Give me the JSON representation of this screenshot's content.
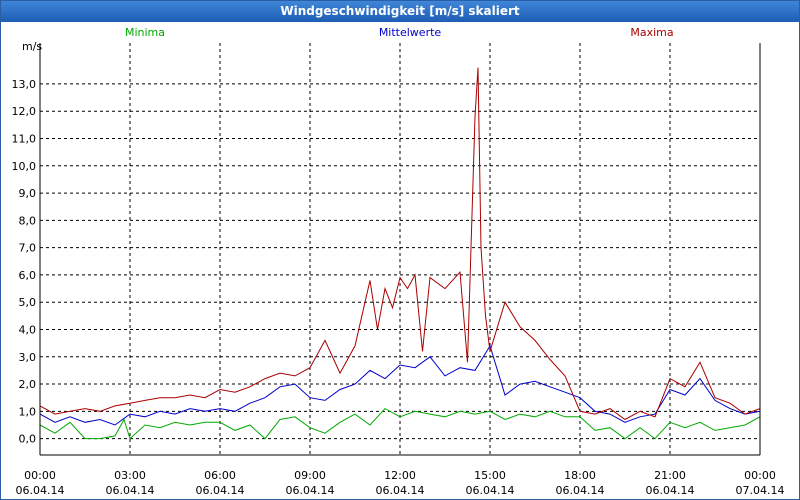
{
  "window": {
    "title": "Windgeschwindigkeit [m/s] skaliert"
  },
  "chart_data": {
    "type": "line",
    "ylabel": "m/s",
    "ylim": [
      -0.6,
      14.5
    ],
    "yticks": [
      0,
      1,
      2,
      3,
      4,
      5,
      6,
      7,
      8,
      9,
      10,
      11,
      12,
      13
    ],
    "ytick_labels": [
      "0,0",
      "1,0",
      "2,0",
      "3,0",
      "4,0",
      "5,0",
      "6,0",
      "7,0",
      "8,0",
      "9,0",
      "10,0",
      "11,0",
      "12,0",
      "13,0"
    ],
    "xlim": [
      0,
      24
    ],
    "xticks": [
      0,
      3,
      6,
      9,
      12,
      15,
      18,
      21,
      24
    ],
    "xtick_times": [
      "00:00",
      "03:00",
      "06:00",
      "09:00",
      "12:00",
      "15:00",
      "18:00",
      "21:00",
      "00:00"
    ],
    "xtick_dates": [
      "06.04.14",
      "06.04.14",
      "06.04.14",
      "06.04.14",
      "06.04.14",
      "06.04.14",
      "06.04.14",
      "06.04.14",
      "07.04.14"
    ],
    "grid": true,
    "series": [
      {
        "name": "Minima",
        "color": "#00aa00",
        "x": [
          0,
          0.5,
          1,
          1.5,
          2,
          2.5,
          2.8,
          3,
          3.5,
          4,
          4.5,
          5,
          5.5,
          6,
          6.5,
          7,
          7.5,
          8,
          8.5,
          9,
          9.5,
          10,
          10.5,
          11,
          11.5,
          12,
          12.5,
          13,
          13.5,
          14,
          14.5,
          15,
          15.5,
          16,
          16.5,
          17,
          17.5,
          18,
          18.5,
          19,
          19.5,
          20,
          20.5,
          21,
          21.5,
          22,
          22.5,
          23,
          23.5,
          24
        ],
        "y": [
          0.5,
          0.2,
          0.6,
          0.0,
          0.0,
          0.1,
          0.7,
          0.0,
          0.5,
          0.4,
          0.6,
          0.5,
          0.6,
          0.6,
          0.3,
          0.5,
          0.0,
          0.7,
          0.8,
          0.4,
          0.2,
          0.6,
          0.9,
          0.5,
          1.1,
          0.8,
          1.0,
          0.9,
          0.8,
          1.0,
          0.9,
          1.0,
          0.7,
          0.9,
          0.8,
          1.0,
          0.8,
          0.8,
          0.3,
          0.4,
          0.0,
          0.4,
          0.0,
          0.6,
          0.4,
          0.6,
          0.3,
          0.4,
          0.5,
          0.8
        ]
      },
      {
        "name": "Mittelwerte",
        "color": "#0000cc",
        "x": [
          0,
          0.5,
          1,
          1.5,
          2,
          2.5,
          3,
          3.5,
          4,
          4.5,
          5,
          5.5,
          6,
          6.5,
          7,
          7.5,
          8,
          8.5,
          9,
          9.5,
          10,
          10.5,
          11,
          11.5,
          12,
          12.5,
          13,
          13.5,
          14,
          14.5,
          15,
          15.5,
          16,
          16.5,
          17,
          17.5,
          18,
          18.5,
          19,
          19.5,
          20,
          20.5,
          21,
          21.5,
          22,
          22.5,
          23,
          23.5,
          24
        ],
        "y": [
          0.9,
          0.6,
          0.8,
          0.6,
          0.7,
          0.5,
          0.9,
          0.8,
          1.0,
          0.9,
          1.1,
          1.0,
          1.1,
          1.0,
          1.3,
          1.5,
          1.9,
          2.0,
          1.5,
          1.4,
          1.8,
          2.0,
          2.5,
          2.2,
          2.7,
          2.6,
          3.0,
          2.3,
          2.6,
          2.5,
          3.4,
          1.6,
          2.0,
          2.1,
          1.9,
          1.7,
          1.5,
          1.0,
          0.9,
          0.6,
          0.8,
          0.9,
          1.8,
          1.6,
          2.2,
          1.4,
          1.1,
          0.9,
          1.0
        ]
      },
      {
        "name": "Maxima",
        "color": "#aa0000",
        "x": [
          0,
          0.5,
          1,
          1.5,
          2,
          2.5,
          3,
          3.5,
          4,
          4.5,
          5,
          5.5,
          6,
          6.5,
          7,
          7.5,
          8,
          8.5,
          9,
          9.5,
          10,
          10.5,
          11,
          11.25,
          11.5,
          11.75,
          12,
          12.25,
          12.5,
          12.75,
          13,
          13.5,
          14,
          14.25,
          14.5,
          14.6,
          14.7,
          14.85,
          15,
          15.5,
          16,
          16.5,
          17,
          17.5,
          18,
          18.5,
          19,
          19.5,
          20,
          20.5,
          21,
          21.5,
          22,
          22.5,
          23,
          23.5,
          24
        ],
        "y": [
          1.2,
          0.9,
          1.0,
          1.1,
          1.0,
          1.2,
          1.3,
          1.4,
          1.5,
          1.5,
          1.6,
          1.5,
          1.8,
          1.7,
          1.9,
          2.2,
          2.4,
          2.3,
          2.6,
          3.6,
          2.4,
          3.4,
          5.8,
          4.0,
          5.5,
          4.8,
          5.9,
          5.5,
          6.0,
          3.2,
          5.9,
          5.5,
          6.1,
          2.8,
          11.8,
          13.6,
          7.0,
          4.5,
          3.2,
          5.0,
          4.1,
          3.6,
          2.9,
          2.3,
          1.0,
          0.9,
          1.1,
          0.7,
          1.0,
          0.8,
          2.2,
          1.9,
          2.8,
          1.5,
          1.3,
          0.9,
          1.1
        ]
      }
    ]
  }
}
